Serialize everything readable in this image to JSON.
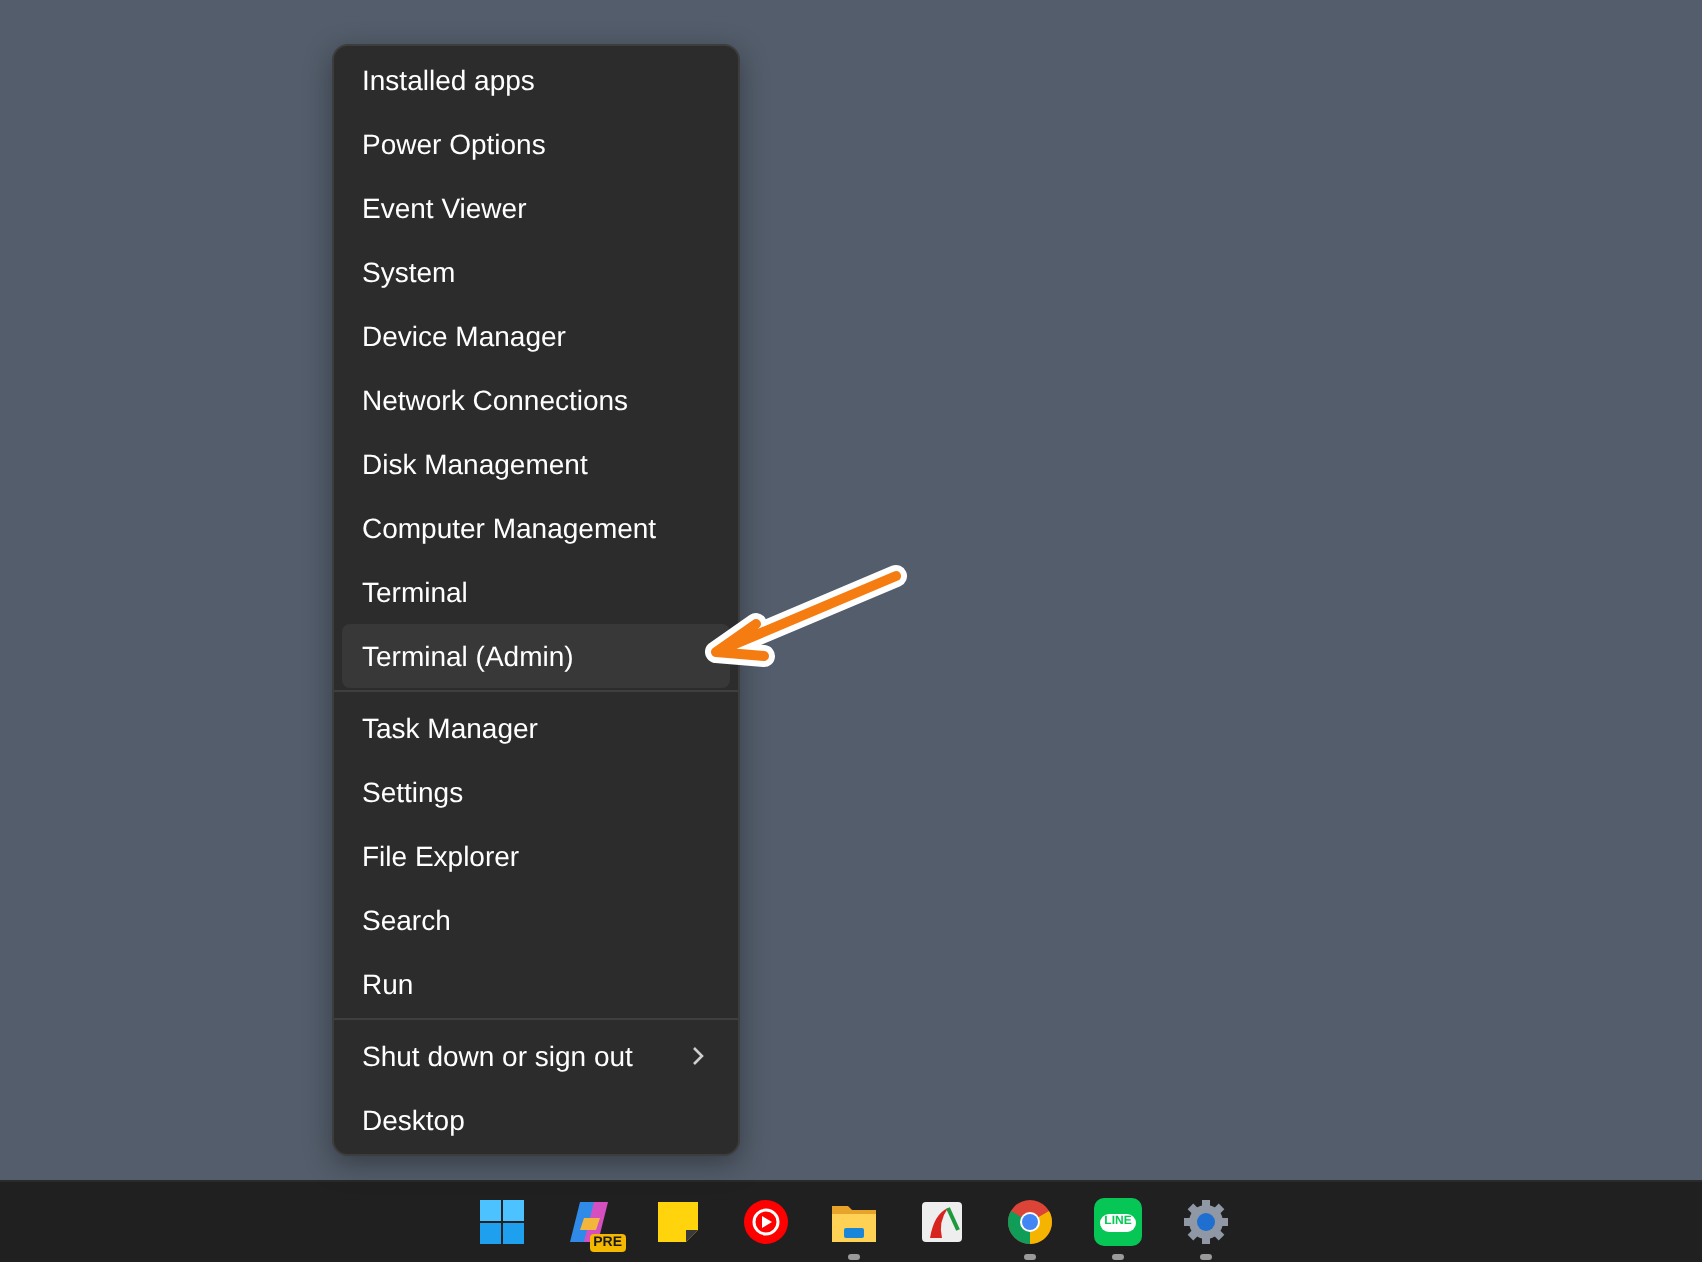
{
  "menu": {
    "sections": [
      [
        {
          "label": "Installed apps",
          "selected": false
        },
        {
          "label": "Power Options",
          "selected": false
        },
        {
          "label": "Event Viewer",
          "selected": false
        },
        {
          "label": "System",
          "selected": false
        },
        {
          "label": "Device Manager",
          "selected": false
        },
        {
          "label": "Network Connections",
          "selected": false
        },
        {
          "label": "Disk Management",
          "selected": false
        },
        {
          "label": "Computer Management",
          "selected": false
        },
        {
          "label": "Terminal",
          "selected": false
        },
        {
          "label": "Terminal (Admin)",
          "selected": true
        }
      ],
      [
        {
          "label": "Task Manager",
          "selected": false
        },
        {
          "label": "Settings",
          "selected": false
        },
        {
          "label": "File Explorer",
          "selected": false
        },
        {
          "label": "Search",
          "selected": false
        },
        {
          "label": "Run",
          "selected": false
        }
      ],
      [
        {
          "label": "Shut down or sign out",
          "selected": false,
          "submenu": true
        },
        {
          "label": "Desktop",
          "selected": false
        }
      ]
    ]
  },
  "taskbar": {
    "apps": [
      {
        "kind": "start",
        "running": false
      },
      {
        "kind": "copilot",
        "running": false,
        "badge": "PRE"
      },
      {
        "kind": "notes",
        "running": false
      },
      {
        "kind": "music",
        "running": false
      },
      {
        "kind": "folder",
        "running": true
      },
      {
        "kind": "pdf",
        "running": false
      },
      {
        "kind": "browser",
        "running": true
      },
      {
        "kind": "chat",
        "running": true,
        "badge": "LINE"
      },
      {
        "kind": "gear",
        "running": true
      }
    ]
  }
}
